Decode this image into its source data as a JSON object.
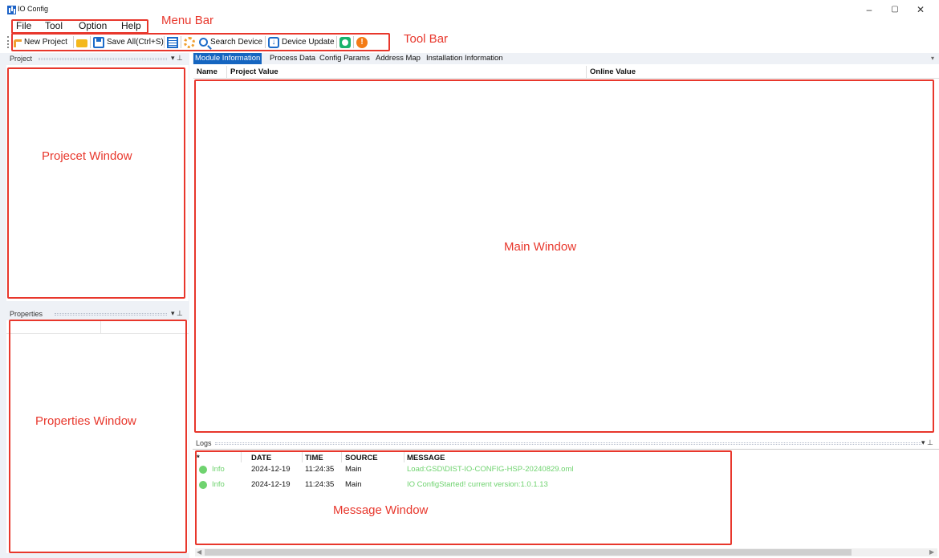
{
  "window": {
    "title": "IO Config",
    "controls": {
      "minimize": "–",
      "maximize": "▢",
      "close": "✕"
    }
  },
  "menu": [
    "File",
    "Tool",
    "Option",
    "Help"
  ],
  "toolbar": {
    "new_project": "New Project",
    "save_all": "Save All(Ctrl+S)",
    "search_device": "Search Device",
    "device_update": "Device Update"
  },
  "panes": {
    "project": {
      "title": "Project",
      "controls": "▾ ⊥"
    },
    "properties": {
      "title": "Properties",
      "controls": "▾ ⊥"
    },
    "logs": {
      "title": "Logs",
      "controls": "▾ ⊥"
    }
  },
  "tabs": [
    {
      "label": "Module Information",
      "active": true
    },
    {
      "label": "Process Data",
      "active": false
    },
    {
      "label": "Config Params",
      "active": false
    },
    {
      "label": "Address Map",
      "active": false
    },
    {
      "label": "Installation Information",
      "active": false
    }
  ],
  "tab_menu": "▾",
  "main_grid": {
    "columns": [
      "Name",
      "Project Value",
      "Online Value"
    ]
  },
  "logs": {
    "columns": [
      "*",
      "DATE",
      "TIME",
      "SOURCE",
      "MESSAGE"
    ],
    "rows": [
      {
        "level": "Info",
        "date": "2024-12-19",
        "time": "11:24:35",
        "source": "Main",
        "message": "Load:GSD\\DIST-IO-CONFIG-HSP-20240829.oml"
      },
      {
        "level": "Info",
        "date": "2024-12-19",
        "time": "11:24:35",
        "source": "Main",
        "message": "IO ConfigStarted! current version:1.0.1.13"
      }
    ]
  },
  "annotations": {
    "menu_bar": "Menu Bar",
    "tool_bar": "Tool Bar",
    "project_window": "Projecet Window",
    "properties_window": "Properties Window",
    "main_window": "Main Window",
    "message_window": "Message Window"
  },
  "colors": {
    "annotation": "#e8372c",
    "active_tab": "#1565c0",
    "info_green": "#6fd36f",
    "pane_header": "#eef1f6"
  }
}
